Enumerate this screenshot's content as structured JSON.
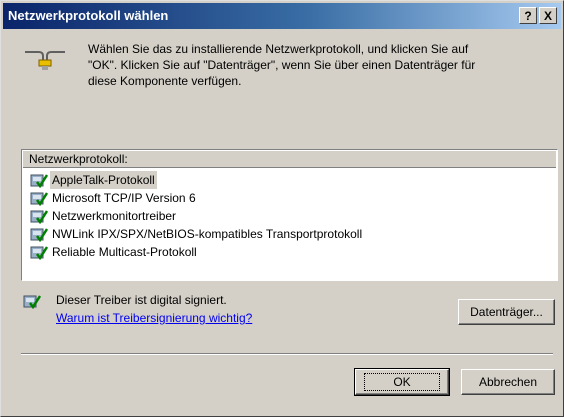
{
  "window": {
    "title": "Netzwerkprotokoll wählen",
    "help_label": "?",
    "close_label": "X"
  },
  "intro": {
    "line1": "Wählen Sie das zu installierende Netzwerkprotokoll, und klicken Sie auf",
    "line2": "\"OK\". Klicken Sie auf \"Datenträger\", wenn Sie über einen Datenträger für",
    "line3": "diese Komponente verfügen.",
    "icon": "network-cable-icon"
  },
  "list": {
    "header": "Netzwerkprotokoll:",
    "items": [
      {
        "label": "AppleTalk-Protokoll",
        "selected": true
      },
      {
        "label": "Microsoft TCP/IP Version 6",
        "selected": false
      },
      {
        "label": "Netzwerkmonitortreiber",
        "selected": false
      },
      {
        "label": "NWLink IPX/SPX/NetBIOS-kompatibles Transportprotokoll",
        "selected": false
      },
      {
        "label": "Reliable Multicast-Protokoll",
        "selected": false
      }
    ],
    "item_icon": "signed-driver-icon"
  },
  "signature": {
    "text": "Dieser Treiber ist digital signiert.",
    "link": "Warum ist Treibersignierung wichtig?",
    "icon": "signed-driver-icon"
  },
  "buttons": {
    "disk": "Datenträger...",
    "ok": "OK",
    "cancel": "Abbrechen"
  },
  "colors": {
    "title_start": "#0a246a",
    "title_end": "#a6caf0",
    "dialog_bg": "#d4d0c8",
    "link": "#0000ee"
  }
}
